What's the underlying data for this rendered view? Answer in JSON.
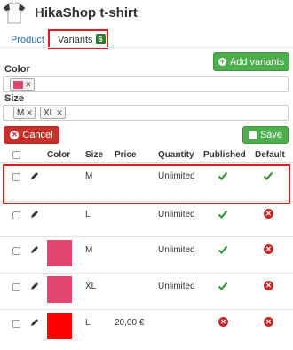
{
  "header": {
    "title": "HikaShop t-shirt",
    "tabs": [
      {
        "label": "Product"
      },
      {
        "label": "Variants",
        "badge": "6"
      }
    ]
  },
  "toolbar": {
    "add_variants_label": "Add variants",
    "cancel_label": "Cancel",
    "save_label": "Save"
  },
  "filters": {
    "color_label": "Color",
    "size_label": "Size",
    "color_values": [
      {
        "swatch": "#e2456d"
      }
    ],
    "size_values": [
      {
        "label": "M"
      },
      {
        "label": "XL"
      }
    ]
  },
  "table": {
    "columns": [
      "Color",
      "Size",
      "Price",
      "Quantity",
      "Published",
      "Default"
    ],
    "rows": [
      {
        "color": "#ffffff",
        "size": "M",
        "price": "",
        "quantity": "Unlimited",
        "published": true,
        "default": true
      },
      {
        "color": "",
        "size": "L",
        "price": "",
        "quantity": "Unlimited",
        "published": true,
        "default": false
      },
      {
        "color": "#e2456d",
        "size": "M",
        "price": "",
        "quantity": "Unlimited",
        "published": true,
        "default": false
      },
      {
        "color": "#e2456d",
        "size": "XL",
        "price": "",
        "quantity": "Unlimited",
        "published": true,
        "default": false
      },
      {
        "color": "#ff0000",
        "size": "L",
        "price": "20,00 €",
        "quantity": "",
        "published": false,
        "default": false
      }
    ]
  },
  "colors": {
    "success": "#4cae4c",
    "danger": "#c9302c",
    "link": "#2a6db0",
    "highlight": "#e21b1b"
  }
}
